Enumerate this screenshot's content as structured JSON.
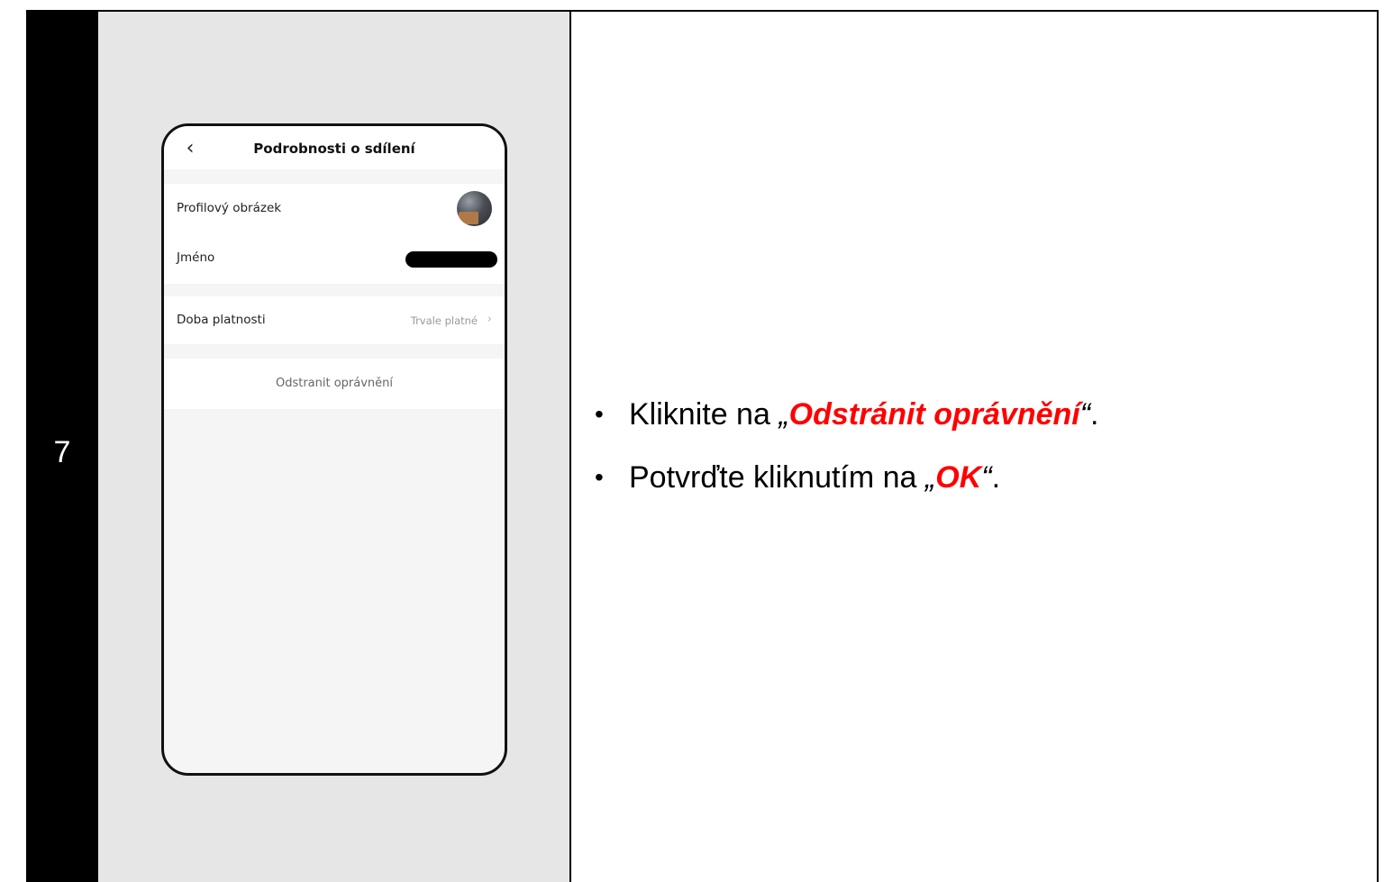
{
  "step": {
    "number": "7"
  },
  "phone": {
    "header": {
      "title": "Podrobnosti o sdílení",
      "back_icon": "chevron-left-icon",
      "back_glyph": "‹"
    },
    "rows": {
      "profile_picture": {
        "label": "Profilový obrázek"
      },
      "name": {
        "label": "Jméno"
      },
      "validity": {
        "label": "Doba platnosti",
        "value": "Trvale platné",
        "chevron_glyph": "›"
      }
    },
    "remove_button": {
      "label": "Odstranit oprávnění"
    }
  },
  "instructions": [
    {
      "prefix": "Kliknite na ",
      "open_quote": "„",
      "highlight": "Odstránit oprávnění",
      "close_quote": "“",
      "suffix": "."
    },
    {
      "prefix": "Potvrďte kliknutím na ",
      "open_quote": "„",
      "highlight": "OK",
      "close_quote": "“",
      "suffix": "."
    }
  ],
  "colors": {
    "highlight": "#ff0000",
    "panel_background": "#e6e6e6",
    "step_column": "#000000"
  }
}
